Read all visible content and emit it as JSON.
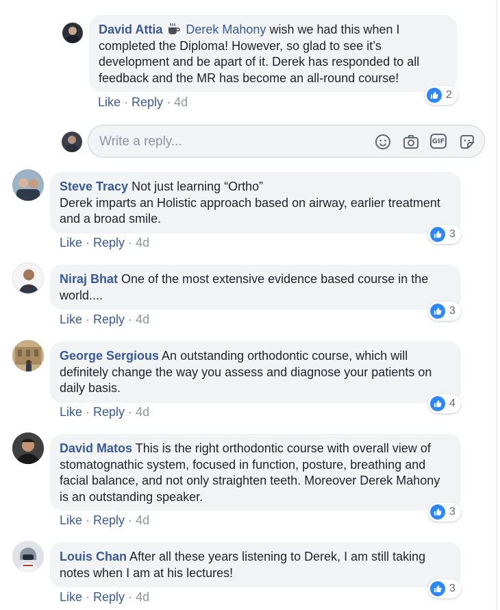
{
  "comments": [
    {
      "author": "David Attia",
      "mention": "Derek Mahony",
      "text": " wish we had this when I completed the Diploma! However, so glad to see it’s development and be apart of it. Derek has responded to all feedback and the MR has become an all-round course!",
      "like_label": "Like",
      "reply_label": "Reply",
      "time": "4d",
      "reaction_count": "2"
    },
    {
      "author": "Steve Tracy",
      "text": " Not just learning “Ortho”",
      "text2": "Derek imparts an Holistic approach based on airway, earlier treatment and a broad smile.",
      "like_label": "Like",
      "reply_label": "Reply",
      "time": "4d",
      "reaction_count": "3"
    },
    {
      "author": "Niraj Bhat",
      "text": " One of the most extensive evidence based course in the world....",
      "like_label": "Like",
      "reply_label": "Reply",
      "time": "4d",
      "reaction_count": "3"
    },
    {
      "author": "George Sergious",
      "text": " An outstanding orthodontic course, which will definitely change the way you assess and diagnose your patients on daily basis.",
      "like_label": "Like",
      "reply_label": "Reply",
      "time": "4d",
      "reaction_count": "4"
    },
    {
      "author": "David Matos",
      "text": " This is the right orthodontic course with overall view of stomatognathic system, focused in function, posture, breathing and facial balance, and not only straighten teeth. Moreover Derek Mahony is an outstanding speaker.",
      "like_label": "Like",
      "reply_label": "Reply",
      "time": "4d",
      "reaction_count": "3"
    },
    {
      "author": "Louis Chan",
      "text": " After all these years listening to Derek, I am still taking notes when I am at his lectures!",
      "like_label": "Like",
      "reply_label": "Reply",
      "time": "4d",
      "reaction_count": "3"
    }
  ],
  "reply_box": {
    "placeholder": "Write a reply...",
    "gif_label": "GIF"
  },
  "colors": {
    "link": "#385898",
    "bubble": "#f2f3f5",
    "like_blue": "#2d88ff",
    "meta": "#90949c"
  },
  "icons": [
    "coffee-icon",
    "emoji-icon",
    "camera-icon",
    "gif-icon",
    "sticker-icon",
    "like-icon"
  ]
}
